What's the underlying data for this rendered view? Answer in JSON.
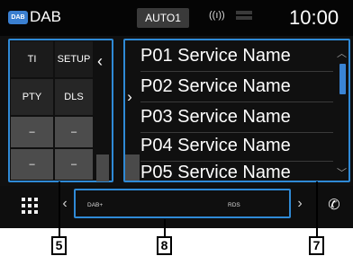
{
  "status_bar": {
    "badge": "DAB",
    "title": "DAB",
    "source_button": "AUTO1",
    "signal_icon": "broadcast-signal-icon",
    "clock": "10:00"
  },
  "controls": {
    "ti": "TI",
    "setup": "SETUP",
    "pty": "PTY",
    "dls": "DLS",
    "blank1": "–",
    "blank2": "–",
    "blank3": "–",
    "blank4": "–"
  },
  "presets": [
    {
      "label": "P01 Service Name"
    },
    {
      "label": "P02 Service Name"
    },
    {
      "label": "P03 Service Name"
    },
    {
      "label": "P04 Service Name"
    },
    {
      "label": "P05 Service Name"
    }
  ],
  "info_bar": {
    "left_text": "DAB+",
    "center_text": "RDS"
  },
  "callouts": {
    "c5": "5",
    "c8": "8",
    "c7": "7"
  },
  "colors": {
    "highlight_border": "#2f8ad6",
    "scroll_thumb": "#3a84d4",
    "background": "#101010"
  }
}
